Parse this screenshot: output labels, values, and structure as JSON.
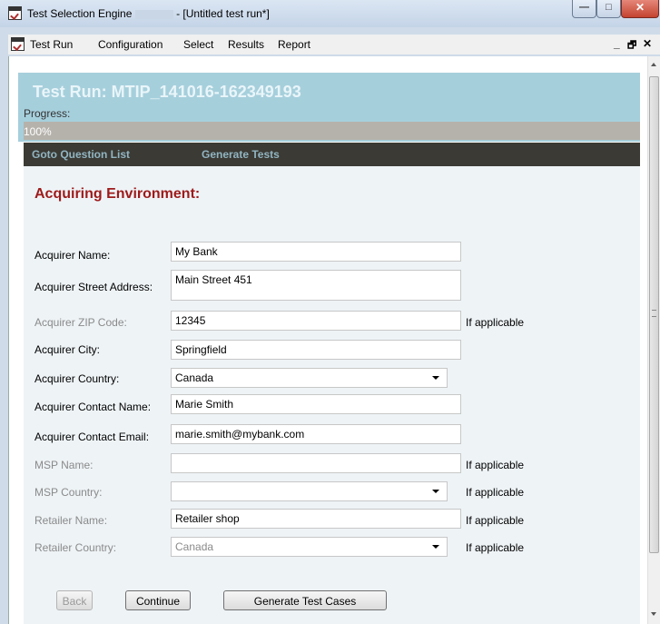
{
  "window": {
    "title_prefix": "Test Selection Engine",
    "title_suffix": "- [Untitled test run*]",
    "min_glyph": "—",
    "max_glyph": "□",
    "close_glyph": "✕"
  },
  "menu": {
    "items": [
      "Test Run",
      "Configuration",
      "Select",
      "Results",
      "Report"
    ],
    "mdi_min": "_",
    "mdi_restore": "🗗",
    "mdi_close": "✕"
  },
  "header": {
    "run_title": "Test Run: MTIP_141016-162349193",
    "progress_label": "Progress:",
    "progress_text": "100%",
    "progress_value": 100
  },
  "nav": {
    "goto_label": "Goto Question List",
    "generate_label": "Generate Tests"
  },
  "form": {
    "section_title": "Acquiring Environment:",
    "if_applicable": "If applicable",
    "fields": {
      "acquirer_name": {
        "label": "Acquirer Name:",
        "value": "My Bank"
      },
      "acquirer_street": {
        "label": "Acquirer Street Address:",
        "value": "Main Street 451"
      },
      "acquirer_zip": {
        "label": "Acquirer ZIP Code:",
        "value": "12345"
      },
      "acquirer_city": {
        "label": "Acquirer City:",
        "value": "Springfield"
      },
      "acquirer_country": {
        "label": "Acquirer Country:",
        "value": "Canada"
      },
      "contact_name": {
        "label": "Acquirer Contact Name:",
        "value": "Marie Smith"
      },
      "contact_email": {
        "label": "Acquirer Contact Email:",
        "value": "marie.smith@mybank.com"
      },
      "msp_name": {
        "label": "MSP Name:",
        "value": ""
      },
      "msp_country": {
        "label": "MSP Country:",
        "value": ""
      },
      "retailer_name": {
        "label": "Retailer Name:",
        "value": "Retailer shop"
      },
      "retailer_country": {
        "label": "Retailer Country:",
        "value": "Canada"
      }
    }
  },
  "buttons": {
    "back": "Back",
    "continue": "Continue",
    "generate": "Generate Test Cases"
  }
}
